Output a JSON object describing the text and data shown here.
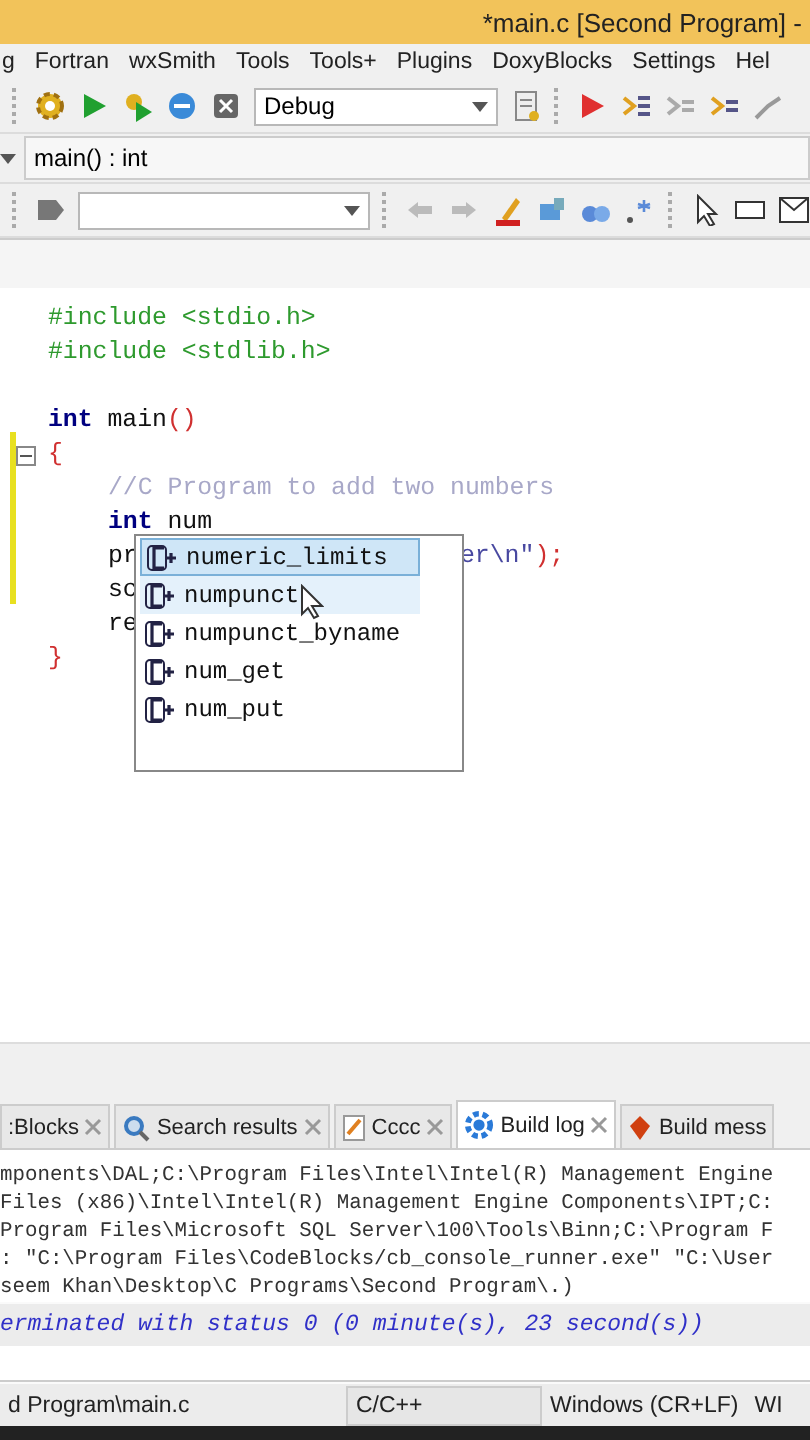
{
  "window": {
    "title": "*main.c [Second Program] -"
  },
  "menu": [
    "g",
    "Fortran",
    "wxSmith",
    "Tools",
    "Tools+",
    "Plugins",
    "DoxyBlocks",
    "Settings",
    "Hel"
  ],
  "build_target": {
    "value": "Debug"
  },
  "scope": {
    "function": "main() : int"
  },
  "editor": {
    "lines": [
      {
        "kind": "code",
        "tokens": [
          {
            "text": "#include <stdio.h>",
            "kind": "preproc"
          }
        ]
      },
      {
        "kind": "code",
        "tokens": [
          {
            "text": "#include <stdlib.h>",
            "kind": "preproc"
          }
        ]
      },
      {
        "kind": "blank"
      },
      {
        "kind": "code",
        "tokens": [
          {
            "text": "int",
            "kind": "keyword"
          },
          {
            "text": " main",
            "kind": "plain"
          },
          {
            "text": "()",
            "kind": "punct"
          }
        ]
      },
      {
        "kind": "code",
        "fold": true,
        "tokens": [
          {
            "text": "{",
            "kind": "punct"
          }
        ]
      },
      {
        "kind": "code",
        "indent": true,
        "tokens": [
          {
            "text": "//C Program to add two numbers",
            "kind": "comment"
          }
        ]
      },
      {
        "kind": "code",
        "indent": true,
        "tokens": [
          {
            "text": "int",
            "kind": "keyword"
          },
          {
            "text": " num",
            "kind": "plain"
          }
        ]
      },
      {
        "kind": "code",
        "indent": true,
        "tokens": [
          {
            "text": "pr",
            "kind": "plain"
          }
        ],
        "tail": [
          {
            "text": "er\\n\"",
            "kind": "string"
          },
          {
            "text": ");",
            "kind": "punct"
          }
        ]
      },
      {
        "kind": "code",
        "indent": true,
        "tokens": [
          {
            "text": "sc",
            "kind": "plain"
          }
        ]
      },
      {
        "kind": "code",
        "indent": true,
        "tokens": [
          {
            "text": "re",
            "kind": "plain"
          }
        ]
      },
      {
        "kind": "code",
        "tokens": [
          {
            "text": "}",
            "kind": "punct"
          }
        ]
      }
    ]
  },
  "autocomplete": {
    "items": [
      {
        "label": "numeric_limits",
        "selected": true,
        "hovered": false
      },
      {
        "label": "numpunct",
        "selected": false,
        "hovered": true
      },
      {
        "label": "numpunct_byname",
        "selected": false,
        "hovered": false
      },
      {
        "label": "num_get",
        "selected": false,
        "hovered": false
      },
      {
        "label": "num_put",
        "selected": false,
        "hovered": false
      }
    ]
  },
  "log_tabs": [
    {
      "label": ":Blocks",
      "selected": false
    },
    {
      "label": "Search results",
      "selected": false
    },
    {
      "label": "Cccc",
      "selected": false
    },
    {
      "label": "Build log",
      "selected": true
    },
    {
      "label": "Build mess",
      "selected": false
    }
  ],
  "build_log": [
    {
      "text": "mponents\\DAL;C:\\Program Files\\Intel\\Intel(R) Management Engine",
      "kind": "normal"
    },
    {
      "text": "Files (x86)\\Intel\\Intel(R) Management Engine Components\\IPT;C:",
      "kind": "normal"
    },
    {
      "text": "Program Files\\Microsoft SQL Server\\100\\Tools\\Binn;C:\\Program F",
      "kind": "normal"
    },
    {
      "text": ": \"C:\\Program Files\\CodeBlocks/cb_console_runner.exe\" \"C:\\User",
      "kind": "normal"
    },
    {
      "text": "seem Khan\\Desktop\\C Programs\\Second Program\\.)",
      "kind": "normal"
    },
    {
      "text": "erminated with status 0 (0 minute(s), 23 second(s))",
      "kind": "status"
    }
  ],
  "status_bar": [
    "d Program\\main.c",
    "C/C++",
    "Windows (CR+LF)",
    "WI"
  ]
}
